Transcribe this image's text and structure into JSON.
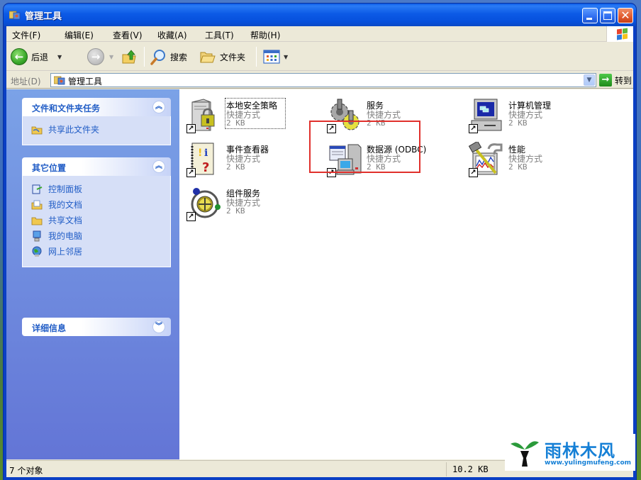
{
  "window": {
    "title": "管理工具",
    "controls": {
      "minimize": "minimize",
      "maximize": "maximize",
      "close": "✕"
    }
  },
  "menubar": {
    "items": [
      {
        "label": "文件(F)"
      },
      {
        "label": "编辑(E)"
      },
      {
        "label": "查看(V)"
      },
      {
        "label": "收藏(A)"
      },
      {
        "label": "工具(T)"
      },
      {
        "label": "帮助(H)"
      }
    ]
  },
  "toolbar": {
    "back_label": "后退",
    "search_label": "搜索",
    "folders_label": "文件夹",
    "back_glyph": "←",
    "forward_glyph": "→",
    "dropdown_glyph": "▼"
  },
  "addressbar": {
    "label": "地址(D)",
    "value": "管理工具",
    "go_label": "转到",
    "go_glyph": "→",
    "drop_glyph": "▼"
  },
  "sidebar": {
    "panels": [
      {
        "title": "文件和文件夹任务",
        "chevron": "︽",
        "items": [
          {
            "label": "共享此文件夹",
            "icon": "share-folder-icon"
          }
        ]
      },
      {
        "title": "其它位置",
        "chevron": "︽",
        "items": [
          {
            "label": "控制面板",
            "icon": "control-panel-icon"
          },
          {
            "label": "我的文档",
            "icon": "my-documents-icon"
          },
          {
            "label": "共享文档",
            "icon": "shared-documents-icon"
          },
          {
            "label": "我的电脑",
            "icon": "my-computer-icon"
          },
          {
            "label": "网上邻居",
            "icon": "network-places-icon"
          }
        ]
      },
      {
        "title": "详细信息",
        "chevron": "︾",
        "items": []
      }
    ]
  },
  "content": {
    "items": [
      {
        "name": "本地安全策略",
        "type": "快捷方式",
        "size": "2 KB",
        "icon": "local-security-policy-icon",
        "focused": true
      },
      {
        "name": "服务",
        "type": "快捷方式",
        "size": "2 KB",
        "icon": "services-icon",
        "highlighted": true
      },
      {
        "name": "计算机管理",
        "type": "快捷方式",
        "size": "2 KB",
        "icon": "computer-management-icon"
      },
      {
        "name": "事件查看器",
        "type": "快捷方式",
        "size": "2 KB",
        "icon": "event-viewer-icon"
      },
      {
        "name": "数据源 (ODBC)",
        "type": "快捷方式",
        "size": "2 KB",
        "icon": "odbc-data-source-icon"
      },
      {
        "name": "性能",
        "type": "快捷方式",
        "size": "2 KB",
        "icon": "performance-icon"
      },
      {
        "name": "组件服务",
        "type": "快捷方式",
        "size": "2 KB",
        "icon": "component-services-icon"
      }
    ],
    "shortcut_glyph": "↗"
  },
  "statusbar": {
    "object_count": "7 个对象",
    "total_size": "10.2 KB"
  },
  "watermark": {
    "title": "雨林木风",
    "url": "www.yulingmufeng.com"
  },
  "colors": {
    "titlebar": "#0a5ae8",
    "sidebar_link": "#215dc6",
    "highlight_box": "#e0302c",
    "watermark": "#1680d6"
  }
}
